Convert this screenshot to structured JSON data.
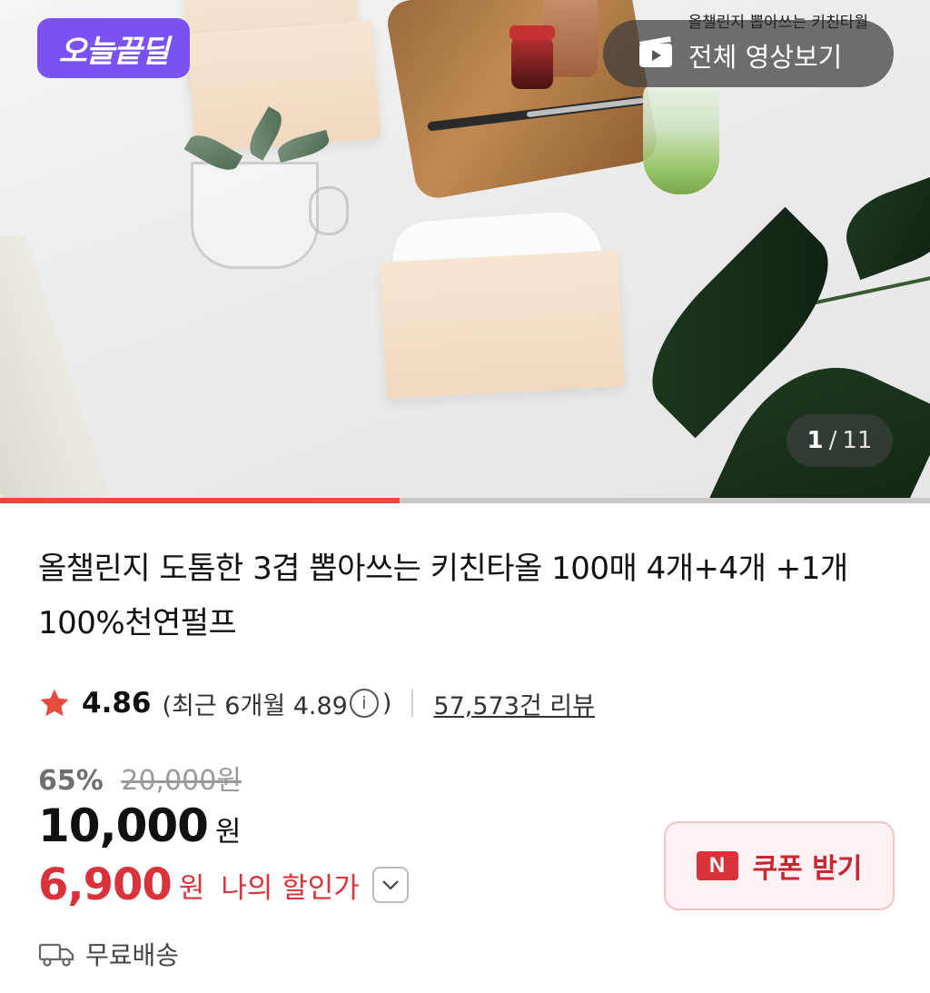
{
  "hero": {
    "deal_badge": "오늘끝딜",
    "video_caption": "올챌린지 뽑아쓰는 키친타월",
    "video_button_label": "전체 영상보기",
    "video_icon": "play-clapper-icon",
    "page_current": "1",
    "page_separator": "/",
    "page_total": "11",
    "progress_fraction": 0.43
  },
  "product": {
    "title": "올챌린지 도톰한 3겹 뽑아쓰는 키친타올 100매 4개+4개 +1개 100%천연펄프",
    "rating": "4.86",
    "rating_recent_prefix": "(최근 6개월 4.89",
    "rating_recent_suffix": ")",
    "info_icon": "info-icon",
    "review_link": "57,573건 리뷰",
    "discount_percent": "65%",
    "original_price": "20,000원",
    "price": "10,000",
    "price_unit": "원",
    "my_price": "6,900",
    "my_price_unit": "원",
    "my_discount_label": "나의 할인가",
    "coupon_badge": "N",
    "coupon_button_label": "쿠폰 받기",
    "shipping": "무료배송"
  },
  "colors": {
    "accent_red": "#d9323a",
    "progress_red": "#e74b3c",
    "deal_purple": "#7a52f4",
    "star": "#e74b3c"
  }
}
